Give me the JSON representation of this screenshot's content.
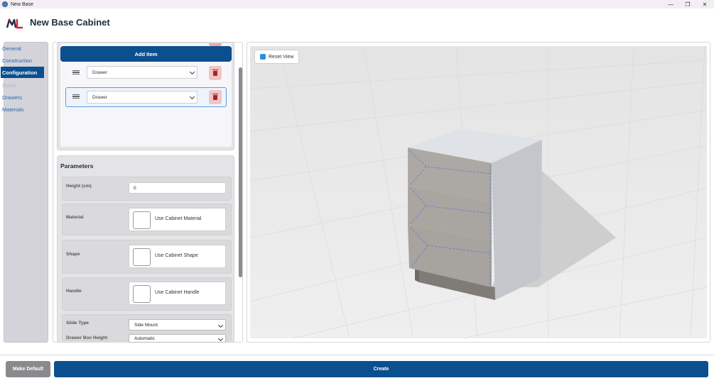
{
  "window": {
    "title": "New Base",
    "controls": {
      "minimize": "—",
      "maximize": "❐",
      "close": "✕"
    }
  },
  "header": {
    "title": "New Base Cabinet",
    "logo_icon": "ml-logo-icon"
  },
  "sidebar": {
    "items": [
      {
        "label": "General",
        "state": "normal"
      },
      {
        "label": "Construction",
        "state": "normal"
      },
      {
        "label": "Configuration",
        "state": "active"
      },
      {
        "label": "Doors",
        "state": "disabled"
      },
      {
        "label": "Drawers",
        "state": "normal"
      },
      {
        "label": "Materials",
        "state": "normal"
      }
    ]
  },
  "items_list": {
    "add_label": "Add Item",
    "rows": [
      {
        "type": "Drawer",
        "selected": false
      },
      {
        "type": "Drawer",
        "selected": true
      }
    ]
  },
  "parameters": {
    "title": "Parameters",
    "height": {
      "label": "Height (cm)",
      "value": "0"
    },
    "material": {
      "label": "Material",
      "value": "Use Cabinet Material"
    },
    "shape": {
      "label": "Shape",
      "value": "Use Cabinet Shape"
    },
    "handle": {
      "label": "Handle",
      "value": "Use Cabinet Handle"
    },
    "slide_type": {
      "label": "Slide Type",
      "value": "Side Mount"
    },
    "drawer_box_height": {
      "label": "Drawer Box Height",
      "value": "Automatic"
    }
  },
  "viewport": {
    "reset_label": "Reset View"
  },
  "footer": {
    "make_default_label": "Make Default",
    "create_label": "Create"
  },
  "colors": {
    "accent": "#0b4f8f",
    "delete_bg": "#f3c4c4",
    "delete_icon": "#a0262b",
    "selected_border": "#5b9be0"
  }
}
